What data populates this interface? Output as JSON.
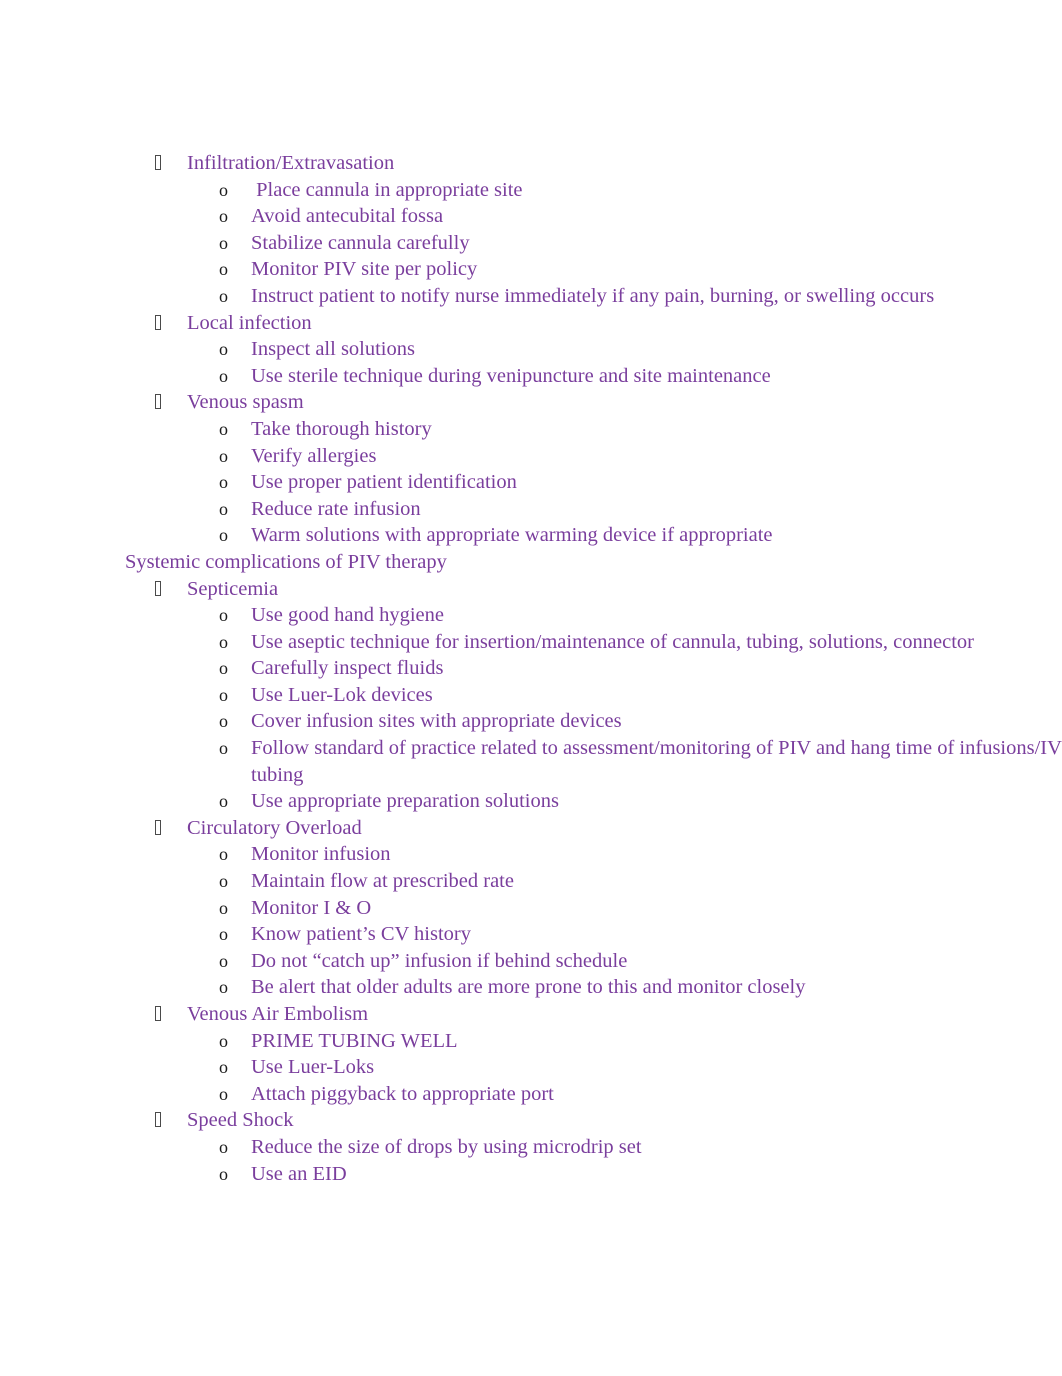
{
  "document": {
    "text_color": "#7A3E9D",
    "marker_color": "#1a1a1a",
    "background_color": "#ffffff",
    "bullet_glyph": "tofu-box",
    "sublist_marker": "o",
    "blocks": [
      {
        "type": "level1",
        "label": "Infiltration/Extravasation",
        "children": [
          " Place cannula in appropriate site",
          "Avoid antecubital fossa",
          "Stabilize cannula carefully",
          "Monitor PIV site per policy",
          "Instruct patient to notify nurse immediately if any pain, burning, or swelling occurs"
        ]
      },
      {
        "type": "level1",
        "label": "Local infection",
        "children": [
          "Inspect all solutions",
          "Use sterile technique during venipuncture and site maintenance"
        ]
      },
      {
        "type": "level1",
        "label": "Venous spasm",
        "children": [
          "Take thorough history",
          "Verify allergies",
          "Use proper patient identification",
          "Reduce rate infusion",
          "Warm solutions with appropriate warming device if appropriate"
        ]
      },
      {
        "type": "heading",
        "label": "Systemic complications of PIV therapy",
        "children": []
      },
      {
        "type": "level1",
        "label": "Septicemia",
        "children": [
          "Use good hand hygiene",
          "Use aseptic technique for insertion/maintenance of cannula, tubing, solutions, connector",
          "Carefully inspect fluids",
          "Use Luer-Lok devices",
          "Cover infusion sites with appropriate devices",
          "Follow standard of practice related to assessment/monitoring of PIV and hang time of infusions/IV tubing",
          "Use appropriate preparation solutions"
        ]
      },
      {
        "type": "level1",
        "label": "Circulatory Overload",
        "children": [
          "Monitor infusion",
          "Maintain flow at prescribed rate",
          "Monitor I & O",
          "Know patient’s CV history",
          "Do not “catch up” infusion if behind schedule",
          "Be alert that older adults are more prone to this and monitor closely"
        ]
      },
      {
        "type": "level1",
        "label": "Venous Air Embolism",
        "children": [
          "PRIME TUBING WELL",
          "Use Luer-Loks",
          "Attach piggyback to appropriate port"
        ]
      },
      {
        "type": "level1",
        "label": "Speed Shock",
        "children": [
          "Reduce the size of drops by using microdrip set",
          "Use an EID"
        ]
      }
    ]
  }
}
